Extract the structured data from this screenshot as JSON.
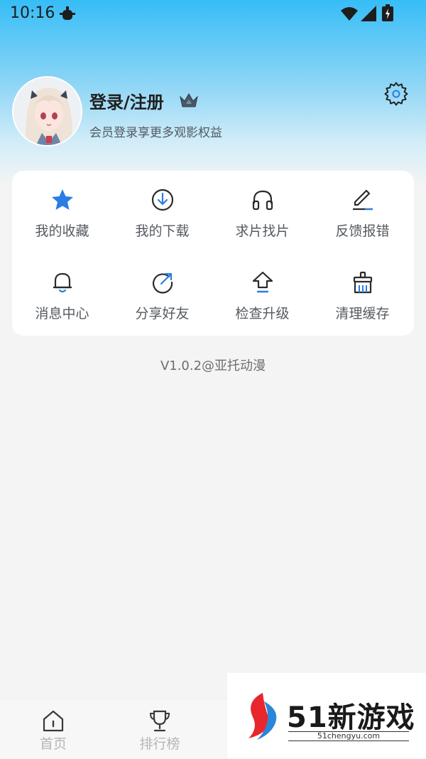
{
  "status_bar": {
    "time": "10:16",
    "icons": [
      "bug-icon",
      "wifi-icon",
      "signal-icon",
      "battery-icon"
    ]
  },
  "profile": {
    "title": "登录/注册",
    "subtitle": "会员登录享更多观影权益",
    "avatar": "anime-avatar",
    "badge_icon": "crown-icon",
    "settings_icon": "gear-icon"
  },
  "menu": {
    "items": [
      {
        "label": "我的收藏",
        "icon": "star-icon"
      },
      {
        "label": "我的下载",
        "icon": "download-icon"
      },
      {
        "label": "求片找片",
        "icon": "headphones-icon"
      },
      {
        "label": "反馈报错",
        "icon": "edit-icon"
      },
      {
        "label": "消息中心",
        "icon": "bell-icon"
      },
      {
        "label": "分享好友",
        "icon": "share-icon"
      },
      {
        "label": "检查升级",
        "icon": "upgrade-icon"
      },
      {
        "label": "清理缓存",
        "icon": "broom-icon"
      }
    ]
  },
  "version": "V1.0.2@亚托动漫",
  "tabbar": {
    "tabs": [
      {
        "label": "首页",
        "icon": "home-icon"
      },
      {
        "label": "排行榜",
        "icon": "trophy-icon"
      }
    ]
  },
  "watermark": {
    "title": "51新游戏",
    "site": "51chengyu.com"
  },
  "colors": {
    "accent": "#2a7de1",
    "header_gradient_top": "#36bdf6"
  }
}
